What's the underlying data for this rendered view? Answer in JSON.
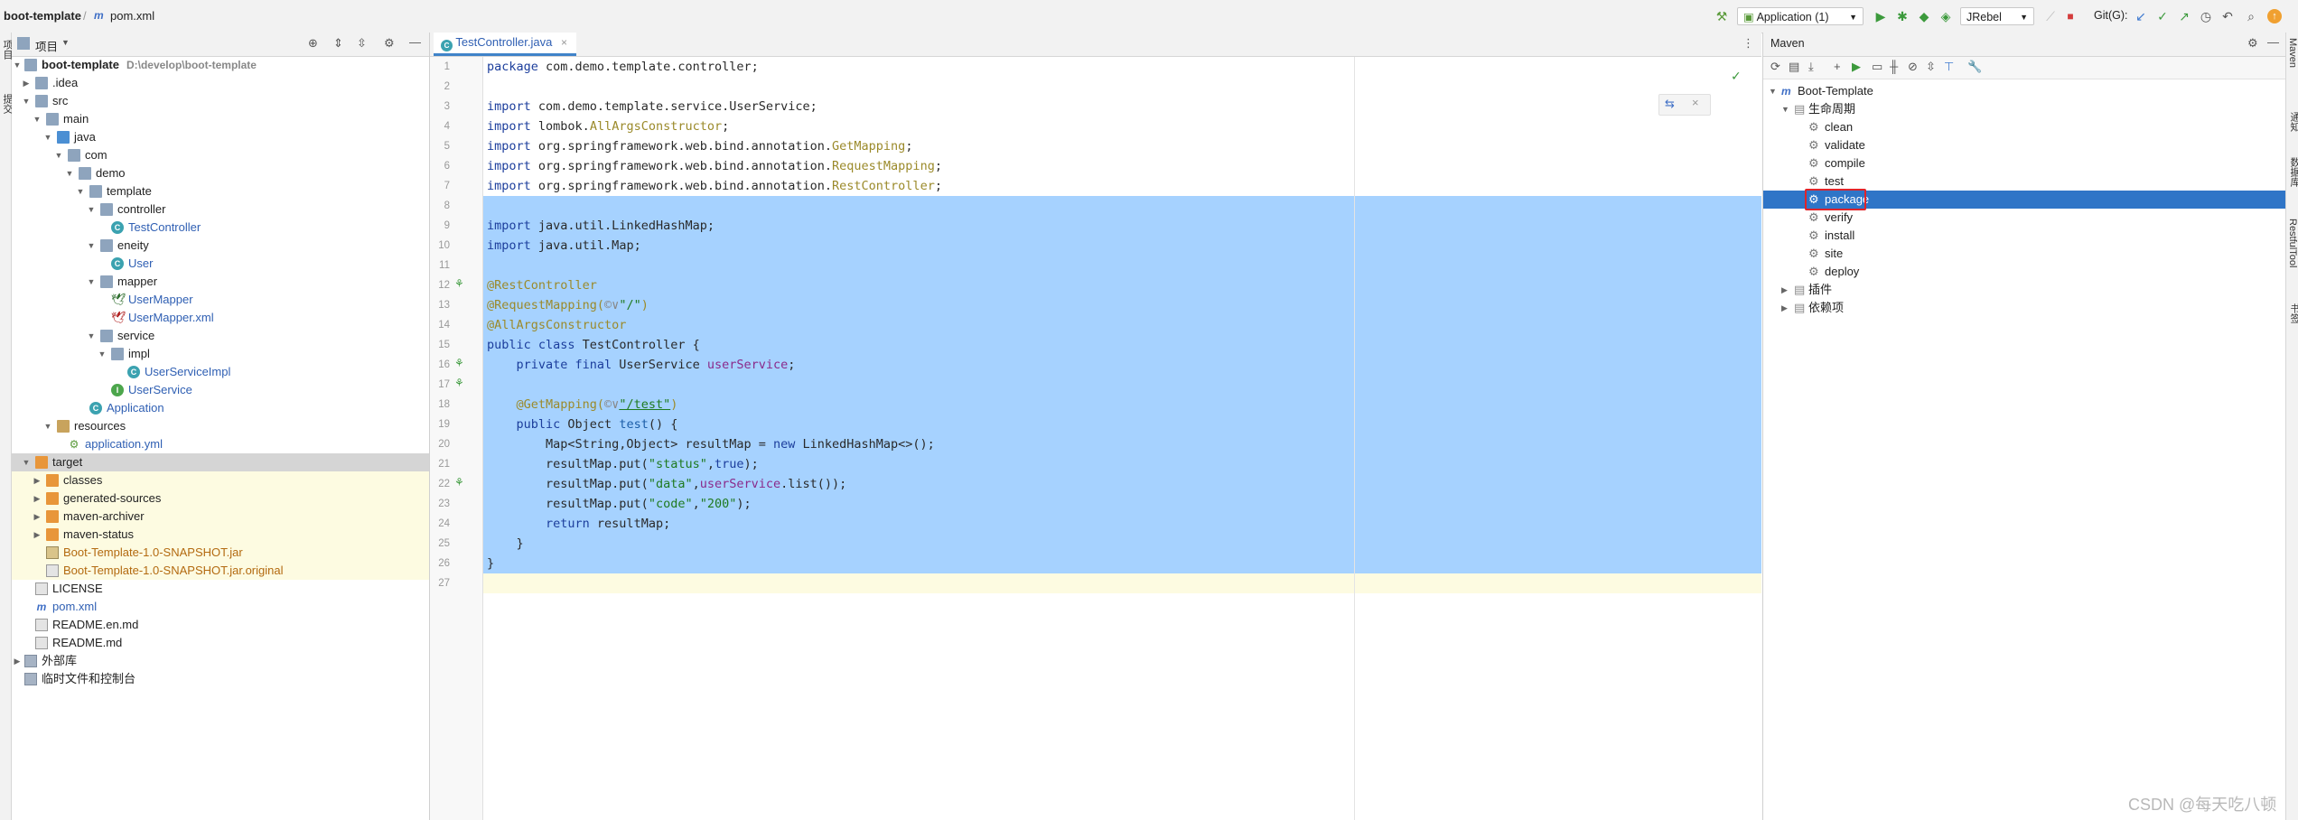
{
  "topbar": {
    "project_name": "boot-template",
    "file_name": "pom.xml",
    "run_config": "Application (1)",
    "jrebel": "JRebel",
    "git_label": "Git(G):"
  },
  "project_panel": {
    "title": "项目",
    "tree": [
      {
        "label": "boot-template",
        "extra": "D:\\develop\\boot-template"
      },
      {
        "label": ".idea"
      },
      {
        "label": "src"
      },
      {
        "label": "main"
      },
      {
        "label": "java"
      },
      {
        "label": "com"
      },
      {
        "label": "demo"
      },
      {
        "label": "template"
      },
      {
        "label": "controller"
      },
      {
        "label": "TestController"
      },
      {
        "label": "eneity"
      },
      {
        "label": "User"
      },
      {
        "label": "mapper"
      },
      {
        "label": "UserMapper"
      },
      {
        "label": "UserMapper.xml"
      },
      {
        "label": "service"
      },
      {
        "label": "impl"
      },
      {
        "label": "UserServiceImpl"
      },
      {
        "label": "UserService"
      },
      {
        "label": "Application"
      },
      {
        "label": "resources"
      },
      {
        "label": "application.yml"
      },
      {
        "label": "target"
      },
      {
        "label": "classes"
      },
      {
        "label": "generated-sources"
      },
      {
        "label": "maven-archiver"
      },
      {
        "label": "maven-status"
      },
      {
        "label": "Boot-Template-1.0-SNAPSHOT.jar"
      },
      {
        "label": "Boot-Template-1.0-SNAPSHOT.jar.original"
      },
      {
        "label": "LICENSE"
      },
      {
        "label": "pom.xml"
      },
      {
        "label": "README.en.md"
      },
      {
        "label": "README.md"
      },
      {
        "label": "外部库"
      },
      {
        "label": "临时文件和控制台"
      }
    ]
  },
  "editor": {
    "tab_label": "TestController.java",
    "line_numbers": [
      "1",
      "2",
      "3",
      "4",
      "5",
      "6",
      "7",
      "8",
      "9",
      "10",
      "11",
      "12",
      "13",
      "14",
      "15",
      "16",
      "17",
      "18",
      "19",
      "20",
      "21",
      "22",
      "23",
      "24",
      "25",
      "26",
      "27"
    ],
    "lines": {
      "l1a": "package",
      "l1b": " com.demo.template.controller;",
      "l3a": "import",
      "l3b": " com.demo.template.service.UserService;",
      "l4a": "import",
      "l4b": " lombok.",
      "l4c": "AllArgsConstructor",
      "l4d": ";",
      "l5a": "import",
      "l5b": " org.springframework.web.bind.annotation.",
      "l5c": "GetMapping",
      "l5d": ";",
      "l6a": "import",
      "l6b": " org.springframework.web.bind.annotation.",
      "l6c": "RequestMapping",
      "l6d": ";",
      "l7a": "import",
      "l7b": " org.springframework.web.bind.annotation.",
      "l7c": "RestController",
      "l7d": ";",
      "l9a": "import",
      "l9b": " java.util.LinkedHashMap;",
      "l10a": "import",
      "l10b": " java.util.Map;",
      "l12": "@RestController",
      "l13a": "@RequestMapping(",
      "l13b": "©∨",
      "l13c": "\"/\"",
      "l13d": ")",
      "l14": "@AllArgsConstructor",
      "l15a": "public class",
      "l15b": " TestController {",
      "l16a": "    private final",
      "l16b": " UserService ",
      "l16c": "userService",
      "l16d": ";",
      "l18a": "    @GetMapping(",
      "l18b": "©∨",
      "l18c": "\"/test\"",
      "l18d": ")",
      "l19a": "    public",
      "l19b": " Object ",
      "l19c": "test",
      "l19d": "() {",
      "l20a": "        Map<String,Object> resultMap = ",
      "l20b": "new",
      "l20c": " LinkedHashMap<>();",
      "l21a": "        resultMap.put(",
      "l21b": "\"status\"",
      "l21c": ",",
      "l21d": "true",
      "l21e": ");",
      "l22a": "        resultMap.put(",
      "l22b": "\"data\"",
      "l22c": ",",
      "l22d": "userService",
      "l22e": ".list());",
      "l23a": "        resultMap.put(",
      "l23b": "\"code\"",
      "l23c": ",",
      "l23d": "\"200\"",
      "l23e": ");",
      "l24a": "        return",
      "l24b": " resultMap;",
      "l25": "    }",
      "l26": "}"
    }
  },
  "maven_panel": {
    "title": "Maven",
    "root": "Boot-Template",
    "lifecycle": "生命周期",
    "goals": [
      "clean",
      "validate",
      "compile",
      "test",
      "package",
      "verify",
      "install",
      "site",
      "deploy"
    ],
    "selected_goal": "package",
    "plugins": "插件",
    "dependencies": "依赖项"
  },
  "side_strips": {
    "left_labels": [
      "项目",
      "提交"
    ],
    "right_labels": [
      "Maven",
      "通知",
      "数据库",
      "RestfulTool",
      "书签"
    ]
  },
  "watermark": "CSDN @每天吃八顿",
  "colors": {
    "selection": "#a6d2ff",
    "maven_selected": "#2f75c7",
    "highlight_box": "#e0242a"
  }
}
